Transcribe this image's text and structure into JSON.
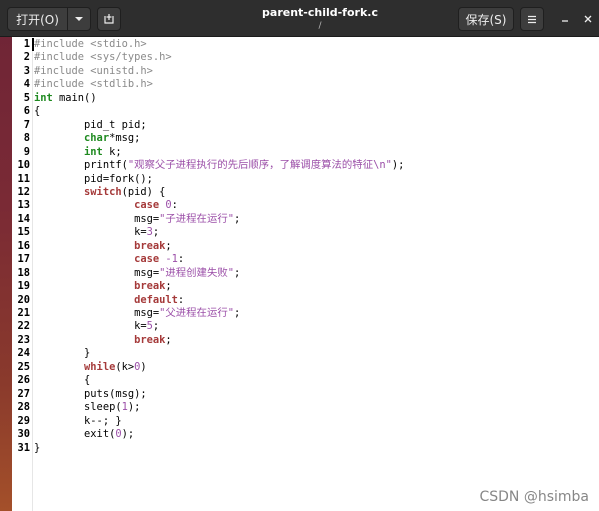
{
  "window": {
    "title": "parent-child-fork.c",
    "subtitle": "/"
  },
  "toolbar": {
    "open_label": "打开(O)",
    "open_menu_icon": "chevron-down-icon",
    "new_document_icon": "new-document-icon",
    "save_label": "保存(S)",
    "menu_icon": "hamburger-menu-icon",
    "minimize_icon": "minimize-icon",
    "close_icon": "close-icon"
  },
  "editor": {
    "lines": [
      {
        "n": "1",
        "tokens": [
          {
            "t": "#include <stdio.h>",
            "c": "pre"
          }
        ]
      },
      {
        "n": "2",
        "tokens": [
          {
            "t": "#include <sys/types.h>",
            "c": "pre"
          }
        ]
      },
      {
        "n": "3",
        "tokens": [
          {
            "t": "#include <unistd.h>",
            "c": "pre"
          }
        ]
      },
      {
        "n": "4",
        "tokens": [
          {
            "t": "#include <stdlib.h>",
            "c": "pre"
          }
        ]
      },
      {
        "n": "5",
        "tokens": [
          {
            "t": "int",
            "c": "type"
          },
          {
            "t": " main()",
            "c": "plain"
          }
        ]
      },
      {
        "n": "6",
        "tokens": [
          {
            "t": "{",
            "c": "plain"
          }
        ]
      },
      {
        "n": "7",
        "tokens": [
          {
            "t": "        pid_t pid;",
            "c": "plain"
          }
        ]
      },
      {
        "n": "8",
        "tokens": [
          {
            "t": "        ",
            "c": "plain"
          },
          {
            "t": "char",
            "c": "type"
          },
          {
            "t": "*msg;",
            "c": "plain"
          }
        ]
      },
      {
        "n": "9",
        "tokens": [
          {
            "t": "        ",
            "c": "plain"
          },
          {
            "t": "int",
            "c": "type"
          },
          {
            "t": " k;",
            "c": "plain"
          }
        ]
      },
      {
        "n": "10",
        "tokens": [
          {
            "t": "        printf(",
            "c": "plain"
          },
          {
            "t": "\"观察父子进程执行的先后顺序，了解调度算法的特征\\n\"",
            "c": "str"
          },
          {
            "t": ");",
            "c": "plain"
          }
        ]
      },
      {
        "n": "11",
        "tokens": [
          {
            "t": "        pid=fork();",
            "c": "plain"
          }
        ]
      },
      {
        "n": "12",
        "tokens": [
          {
            "t": "        ",
            "c": "plain"
          },
          {
            "t": "switch",
            "c": "kw"
          },
          {
            "t": "(pid) {",
            "c": "plain"
          }
        ]
      },
      {
        "n": "13",
        "tokens": [
          {
            "t": "                ",
            "c": "plain"
          },
          {
            "t": "case",
            "c": "kw"
          },
          {
            "t": " ",
            "c": "plain"
          },
          {
            "t": "0",
            "c": "num"
          },
          {
            "t": ":",
            "c": "plain"
          }
        ]
      },
      {
        "n": "14",
        "tokens": [
          {
            "t": "                msg=",
            "c": "plain"
          },
          {
            "t": "\"子进程在运行\"",
            "c": "str"
          },
          {
            "t": ";",
            "c": "plain"
          }
        ]
      },
      {
        "n": "15",
        "tokens": [
          {
            "t": "                k=",
            "c": "plain"
          },
          {
            "t": "3",
            "c": "num"
          },
          {
            "t": ";",
            "c": "plain"
          }
        ]
      },
      {
        "n": "16",
        "tokens": [
          {
            "t": "                ",
            "c": "plain"
          },
          {
            "t": "break",
            "c": "kw"
          },
          {
            "t": ";",
            "c": "plain"
          }
        ]
      },
      {
        "n": "17",
        "tokens": [
          {
            "t": "                ",
            "c": "plain"
          },
          {
            "t": "case",
            "c": "kw"
          },
          {
            "t": " ",
            "c": "plain"
          },
          {
            "t": "-1",
            "c": "num"
          },
          {
            "t": ":",
            "c": "plain"
          }
        ]
      },
      {
        "n": "18",
        "tokens": [
          {
            "t": "                msg=",
            "c": "plain"
          },
          {
            "t": "\"进程创建失败\"",
            "c": "str"
          },
          {
            "t": ";",
            "c": "plain"
          }
        ]
      },
      {
        "n": "19",
        "tokens": [
          {
            "t": "                ",
            "c": "plain"
          },
          {
            "t": "break",
            "c": "kw"
          },
          {
            "t": ";",
            "c": "plain"
          }
        ]
      },
      {
        "n": "20",
        "tokens": [
          {
            "t": "                ",
            "c": "plain"
          },
          {
            "t": "default",
            "c": "kw"
          },
          {
            "t": ":",
            "c": "plain"
          }
        ]
      },
      {
        "n": "21",
        "tokens": [
          {
            "t": "                msg=",
            "c": "plain"
          },
          {
            "t": "\"父进程在运行\"",
            "c": "str"
          },
          {
            "t": ";",
            "c": "plain"
          }
        ]
      },
      {
        "n": "22",
        "tokens": [
          {
            "t": "                k=",
            "c": "plain"
          },
          {
            "t": "5",
            "c": "num"
          },
          {
            "t": ";",
            "c": "plain"
          }
        ]
      },
      {
        "n": "23",
        "tokens": [
          {
            "t": "                ",
            "c": "plain"
          },
          {
            "t": "break",
            "c": "kw"
          },
          {
            "t": ";",
            "c": "plain"
          }
        ]
      },
      {
        "n": "24",
        "tokens": [
          {
            "t": "        }",
            "c": "plain"
          }
        ]
      },
      {
        "n": "25",
        "tokens": [
          {
            "t": "        ",
            "c": "plain"
          },
          {
            "t": "while",
            "c": "kw"
          },
          {
            "t": "(k>",
            "c": "plain"
          },
          {
            "t": "0",
            "c": "num"
          },
          {
            "t": ")",
            "c": "plain"
          }
        ]
      },
      {
        "n": "26",
        "tokens": [
          {
            "t": "        {",
            "c": "plain"
          }
        ]
      },
      {
        "n": "27",
        "tokens": [
          {
            "t": "        puts(msg);",
            "c": "plain"
          }
        ]
      },
      {
        "n": "28",
        "tokens": [
          {
            "t": "        sleep(",
            "c": "plain"
          },
          {
            "t": "1",
            "c": "num"
          },
          {
            "t": ");",
            "c": "plain"
          }
        ]
      },
      {
        "n": "29",
        "tokens": [
          {
            "t": "        k--; }",
            "c": "plain"
          }
        ]
      },
      {
        "n": "30",
        "tokens": [
          {
            "t": "        exit(",
            "c": "plain"
          },
          {
            "t": "0",
            "c": "num"
          },
          {
            "t": ");",
            "c": "plain"
          }
        ]
      },
      {
        "n": "31",
        "tokens": [
          {
            "t": "}",
            "c": "plain"
          }
        ]
      }
    ]
  },
  "watermark": "CSDN @hsimba",
  "colors": {
    "headerbar": "#2e2e2e",
    "keyword": "#a53a3a",
    "type": "#1f8a20",
    "preprocessor": "#8a8a8a",
    "string": "#9b4fa8"
  }
}
